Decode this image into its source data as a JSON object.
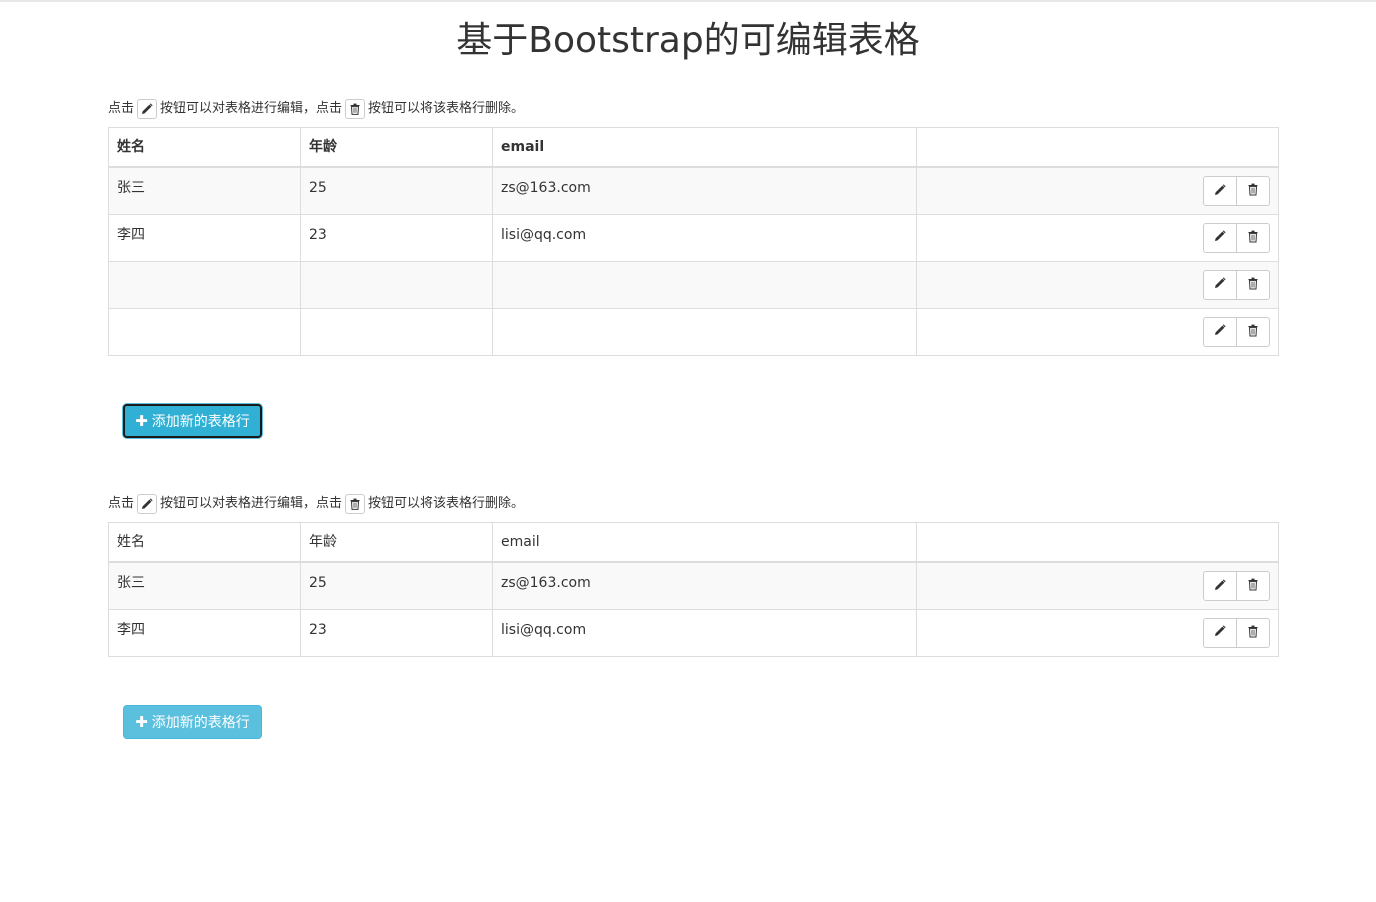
{
  "page": {
    "title": "基于Bootstrap的可编辑表格"
  },
  "instructions": {
    "prefix": "点击",
    "middle": "按钮可以对表格进行编辑，点击",
    "suffix": "按钮可以将该表格行删除。",
    "edit_icon": "pencil-icon",
    "delete_icon": "trash-icon"
  },
  "table1": {
    "headers": [
      "姓名",
      "年龄",
      "email",
      ""
    ],
    "header_weight": "bold",
    "rows": [
      {
        "name": "张三",
        "age": "25",
        "email": "zs@163.com"
      },
      {
        "name": "李四",
        "age": "23",
        "email": "lisi@qq.com"
      },
      {
        "name": "",
        "age": "",
        "email": ""
      },
      {
        "name": "",
        "age": "",
        "email": ""
      }
    ],
    "add_button_label": "添加新的表格行",
    "add_button_state": "focused"
  },
  "table2": {
    "headers": [
      "姓名",
      "年龄",
      "email",
      ""
    ],
    "header_weight": "normal",
    "rows": [
      {
        "name": "张三",
        "age": "25",
        "email": "zs@163.com"
      },
      {
        "name": "李四",
        "age": "23",
        "email": "lisi@qq.com"
      }
    ],
    "add_button_label": "添加新的表格行",
    "add_button_state": "normal"
  },
  "colors": {
    "info_button": "#5bc0de",
    "info_button_border": "#46b8da",
    "table_border": "#dddddd",
    "stripe": "#f9f9f9"
  }
}
